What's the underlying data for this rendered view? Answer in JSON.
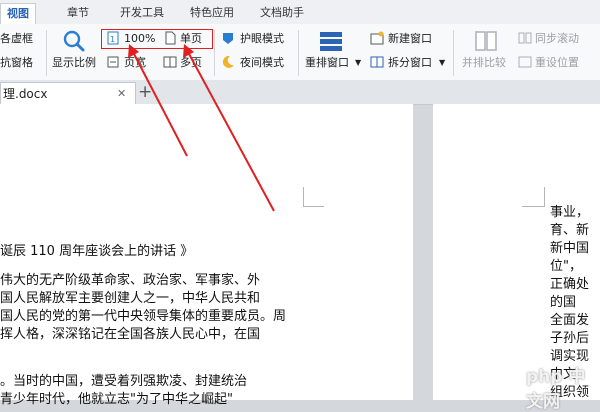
{
  "menu_tabs": [
    "视图",
    "章节",
    "开发工具",
    "特色应用",
    "文档助手"
  ],
  "ribbon": {
    "outline_label": "各虚框",
    "nav_pane_label": "抗窗格",
    "zoom_button_label": "显示比例",
    "zoom_value": "100%",
    "single_page_label": "单页",
    "page_width_label": "页宽",
    "multi_page_label": "多页",
    "eye_protect_label": "护眼模式",
    "night_mode_label": "夜间模式",
    "rearrange_window_label": "重排窗口",
    "new_window_label": "新建窗口",
    "split_window_label": "拆分窗口",
    "side_by_side_label": "并排比较",
    "sync_scroll_label": "同步滚动",
    "reset_position_label": "重设位置"
  },
  "colors": {
    "accent": "#2b63b6",
    "annotation": "#e02020"
  },
  "document": {
    "tab_name": "理.docx",
    "left_lines": [
      "诞辰 110 周年座谈会上的讲话 》",
      "伟大的无产阶级革命家、政治家、军事家、外",
      "国人民解放军主要创建人之一，中华人民共和",
      "国人民的党的第一代中央领导集体的重要成员。周",
      "挥人格，深深铭记在全国各族人民心中，在国",
      "。当时的中国，遭受着列强欺凌、封建统治",
      "青少年时代，他就立志\"为了中华之崛起\""
    ],
    "right_lines": [
      "事业，",
      "育、新",
      "新中国",
      "位\"，",
      "正确处",
      "的国",
      "全面发",
      "子孙后",
      "调实现",
      "中文",
      "组织领"
    ]
  },
  "watermark": "php 中文网"
}
